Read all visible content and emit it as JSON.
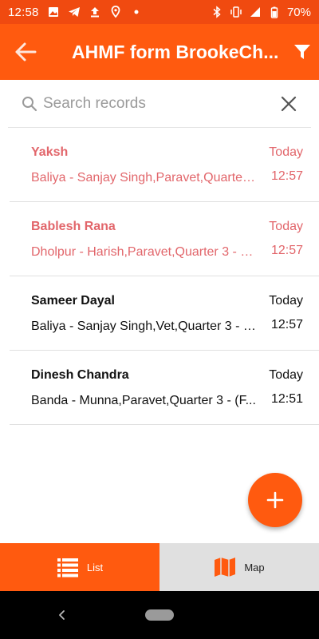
{
  "status_bar": {
    "time": "12:58",
    "battery": "70%",
    "left_icons": [
      "image-icon",
      "telegram-icon",
      "upload-icon",
      "location-icon",
      "dot-icon"
    ],
    "right_icons": [
      "bluetooth-icon",
      "vibrate-icon",
      "signal-icon",
      "battery-icon"
    ]
  },
  "app_bar": {
    "title": "AHMF form BrookeCh...",
    "back_icon": "arrow-left-icon",
    "filter_icon": "filter-icon"
  },
  "search": {
    "placeholder": "Search records",
    "value": ""
  },
  "records": [
    {
      "title": "Yaksh",
      "subtitle": "Baliya - Sanjay Singh,Paravet,Quarter...",
      "date": "Today",
      "time": "12:57",
      "highlight": true
    },
    {
      "title": "Bablesh Rana",
      "subtitle": "Dholpur - Harish,Paravet,Quarter 3 - (F...",
      "date": "Today",
      "time": "12:57",
      "highlight": true
    },
    {
      "title": "Sameer Dayal",
      "subtitle": "Baliya - Sanjay Singh,Vet,Quarter 3 - (...",
      "date": "Today",
      "time": "12:57",
      "highlight": false
    },
    {
      "title": "Dinesh Chandra",
      "subtitle": "Banda - Munna,Paravet,Quarter 3 - (F...",
      "date": "Today",
      "time": "12:51",
      "highlight": false
    }
  ],
  "tabs": {
    "list_label": "List",
    "map_label": "Map",
    "active": "List"
  },
  "colors": {
    "accent": "#ff5a0f",
    "status_bar": "#f04a10",
    "highlight_text": "#e2666b",
    "inactive_tab": "#e0e0e0"
  }
}
